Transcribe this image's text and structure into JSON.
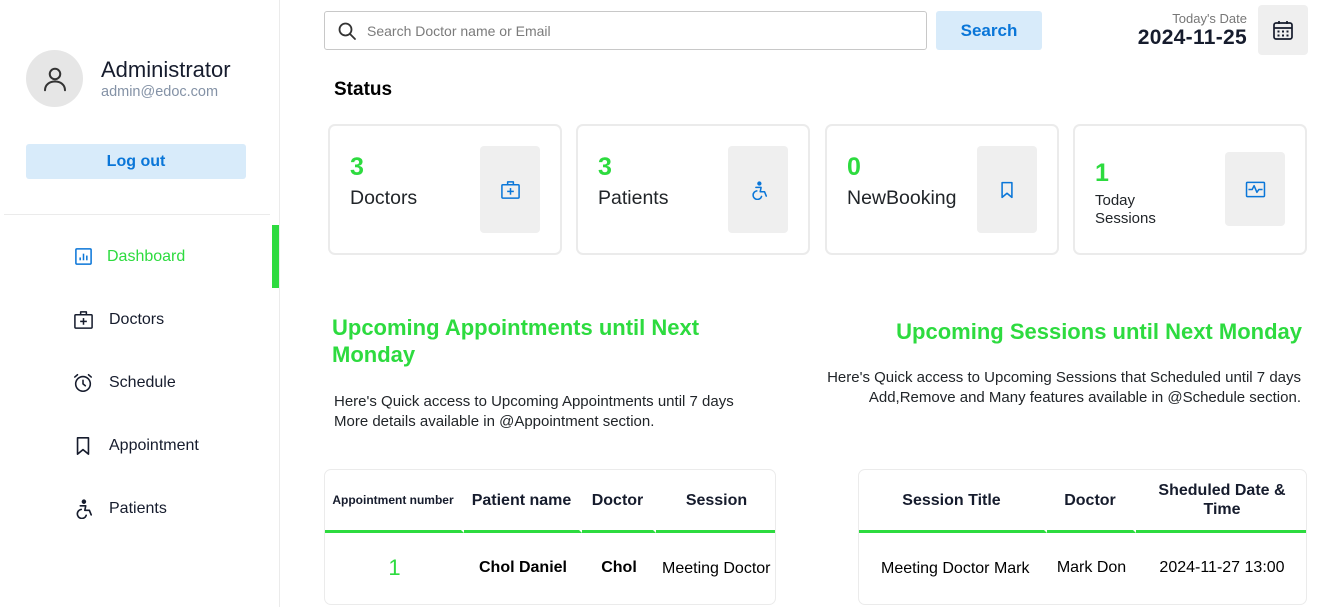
{
  "profile": {
    "name": "Administrator",
    "email": "admin@edoc.com",
    "logout_label": "Log out"
  },
  "nav": {
    "dashboard": "Dashboard",
    "doctors": "Doctors",
    "schedule": "Schedule",
    "appointment": "Appointment",
    "patients": "Patients"
  },
  "search": {
    "placeholder": "Search Doctor name or Email",
    "button_label": "Search"
  },
  "date": {
    "label": "Today's Date",
    "value": "2024-11-25"
  },
  "status": {
    "title": "Status",
    "cards": [
      {
        "value": "3",
        "label": "Doctors"
      },
      {
        "value": "3",
        "label": "Patients"
      },
      {
        "value": "0",
        "label": "NewBooking"
      },
      {
        "value": "1",
        "label": "Today Sessions"
      }
    ]
  },
  "appointments": {
    "heading": "Upcoming Appointments until Next Monday",
    "desc_line1": "Here's Quick access to Upcoming Appointments until 7 days",
    "desc_line2": "More details available in @Appointment section.",
    "columns": [
      "Appointment number",
      "Patient name",
      "Doctor",
      "Session"
    ],
    "rows": [
      {
        "number": "1",
        "patient": "Chol Daniel",
        "doctor": "Chol",
        "session": "Meeting Doctor"
      }
    ]
  },
  "sessions": {
    "heading": "Upcoming Sessions until Next Monday",
    "desc_line1": "Here's Quick access to Upcoming Sessions that Scheduled until 7 days",
    "desc_line2": "Add,Remove and Many features available in @Schedule section.",
    "columns": [
      "Session Title",
      "Doctor",
      "Sheduled Date & Time"
    ],
    "rows": [
      {
        "title": "Meeting Doctor Mark",
        "doctor": "Mark Don",
        "datetime": "2024-11-27 13:00"
      }
    ]
  },
  "colors": {
    "accent_green": "#2ddb3f",
    "accent_blue": "#0a76d8",
    "button_bg": "#d8ebfa"
  }
}
